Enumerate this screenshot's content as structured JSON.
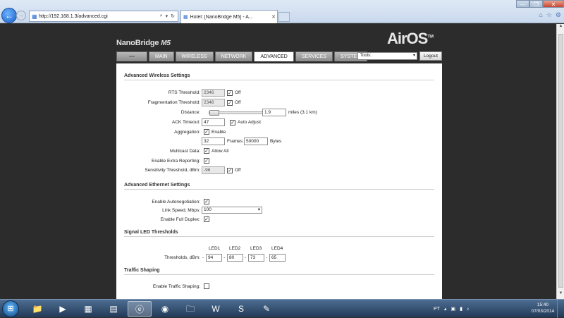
{
  "browser": {
    "url": "http://192.168.1.3/advanced.cgi",
    "tab_title": "Hotel: [NanoBridge M5] - A...",
    "win_min": "—",
    "win_max": "❐",
    "win_close": "✕"
  },
  "device": {
    "brand": "NanoBridge",
    "model": "M5",
    "logo": "AirOS",
    "logo_tm": "TM"
  },
  "nav": {
    "tabs": [
      "MAIN",
      "WIRELESS",
      "NETWORK",
      "ADVANCED",
      "SERVICES",
      "SYSTEM"
    ],
    "active": "ADVANCED",
    "tools_label": "Tools:",
    "logout_label": "Logout"
  },
  "wireless": {
    "title": "Advanced Wireless Settings",
    "rts_label": "RTS Threshold:",
    "rts_value": "2346",
    "rts_off": "Off",
    "frag_label": "Fragmentation Threshold:",
    "frag_value": "2346",
    "frag_off": "Off",
    "distance_label": "Distance:",
    "distance_value": "1.9",
    "distance_unit": "miles (3.1 km)",
    "ack_label": "ACK Timeout:",
    "ack_value": "47",
    "ack_auto": "Auto Adjust",
    "agg_label": "Aggregation:",
    "agg_enable": "Enable",
    "agg_frames_value": "32",
    "agg_frames_unit": "Frames",
    "agg_bytes_value": "50000",
    "agg_bytes_unit": "Bytes",
    "mcast_label": "Multicast Data:",
    "mcast_allow": "Allow All",
    "extra_label": "Enable Extra Reporting:",
    "sens_label": "Sensitivity Threshold, dBm:",
    "sens_value": "-96",
    "sens_off": "Off"
  },
  "ethernet": {
    "title": "Advanced Ethernet Settings",
    "autoneg_label": "Enable Autonegotiation:",
    "speed_label": "Link Speed, Mbps:",
    "speed_value": "100",
    "duplex_label": "Enable Full Duplex:"
  },
  "led": {
    "title": "Signal LED Thresholds",
    "headers": [
      "LED1",
      "LED2",
      "LED3",
      "LED4"
    ],
    "label": "Thresholds, dBm:",
    "prefix": "-",
    "values": [
      "94",
      "80",
      "73",
      "65"
    ]
  },
  "shaping": {
    "title": "Traffic Shaping",
    "enable_label": "Enable Traffic Shaping:"
  },
  "checkmark": "✓",
  "taskbar": {
    "lang": "PT",
    "time": "15:40",
    "date": "07/03/2014"
  },
  "icons": {
    "back": "←",
    "forward": "→",
    "search": "⌕",
    "refresh": "↻",
    "close": "✕",
    "home": "⌂",
    "star": "☆",
    "gear": "⚙",
    "dropdown": "▾",
    "scroll_up": "▲",
    "scroll_down": "▼",
    "start": "⊞"
  }
}
